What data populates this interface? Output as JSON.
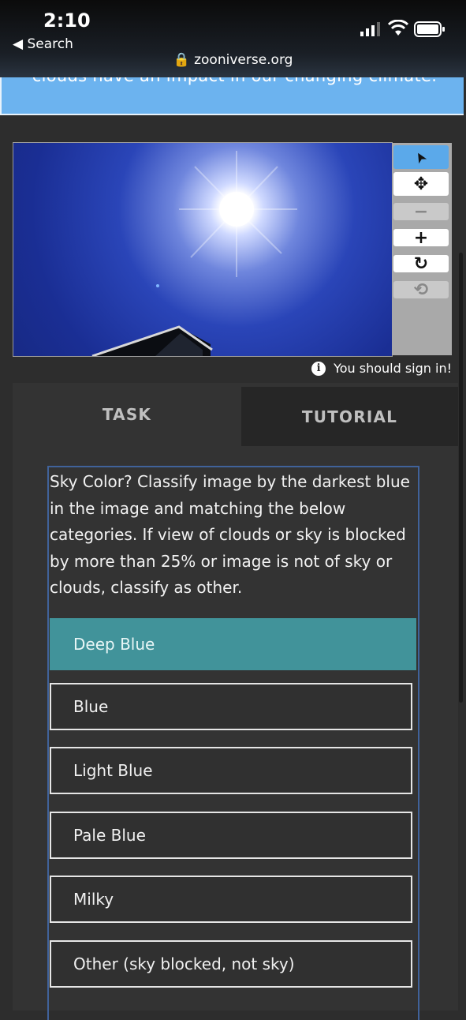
{
  "status_bar": {
    "time": "2:10",
    "back_label": "◀ Search",
    "url": "zooniverse.org"
  },
  "banner": {
    "text": "clouds have an impact in our changing climate."
  },
  "viewer_tools": {
    "pointer": "➤",
    "move": "✥",
    "zoom_out": "−",
    "zoom_in": "+",
    "rotate": "↻",
    "reset": "⟲"
  },
  "notice": {
    "text": "You should sign in!"
  },
  "tabs": [
    {
      "label": "TASK"
    },
    {
      "label": "TUTORIAL"
    }
  ],
  "task": {
    "question": "Sky Color? Classify image by the darkest blue in the image and matching the below categories. If view of clouds or sky is blocked by more than 25% or image is not of sky or clouds, classify as other.",
    "answers": [
      {
        "label": "Deep Blue",
        "selected": true
      },
      {
        "label": "Blue"
      },
      {
        "label": "Light Blue"
      },
      {
        "label": "Pale Blue"
      },
      {
        "label": "Milky"
      },
      {
        "label": "Other (sky blocked, not sky)"
      }
    ]
  },
  "colors": {
    "selected_answer": "#41939a",
    "banner": "#6cb3ef",
    "active_tool": "#5ba9ea"
  }
}
